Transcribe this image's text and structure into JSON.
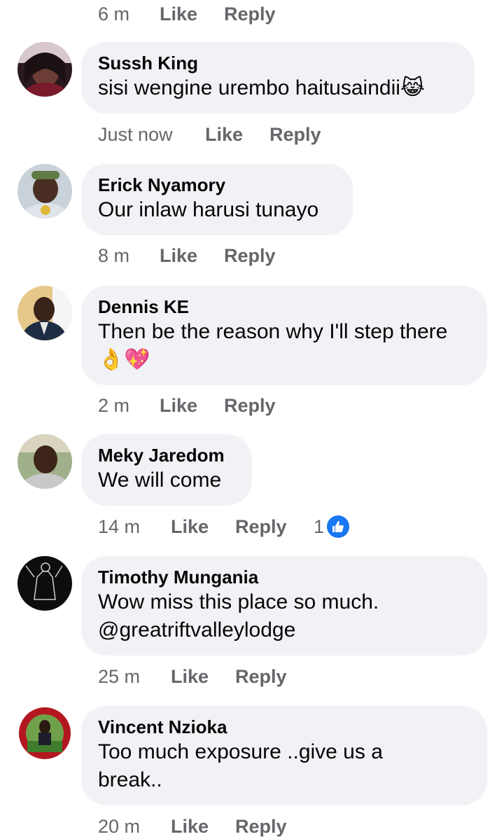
{
  "top_actions": {
    "time": "6 m",
    "like": "Like",
    "reply": "Reply"
  },
  "comments": [
    {
      "name": "Sussh King",
      "text": "sisi wengine urembo haitusaindii",
      "emoji": "😹",
      "time": "Just now",
      "like": "Like",
      "reply": "Reply"
    },
    {
      "name": "Erick Nyamory",
      "text": "Our inlaw harusi tunayo",
      "time": "8 m",
      "like": "Like",
      "reply": "Reply"
    },
    {
      "name": "Dennis KE",
      "text": "Then be the reason why I'll step there",
      "emoji": "👌💖",
      "time": "2 m",
      "like": "Like",
      "reply": "Reply"
    },
    {
      "name": "Meky Jaredom",
      "text": "We will come",
      "time": "14 m",
      "like": "Like",
      "reply": "Reply",
      "reaction_count": "1"
    },
    {
      "name": "Timothy Mungania",
      "text_line1": "Wow miss this place so much.",
      "text_line2": "@greatriftvalleylodge",
      "time": "25 m",
      "like": "Like",
      "reply": "Reply"
    },
    {
      "name": "Vincent Nzioka",
      "text_line1": "Too much exposure ..give us a",
      "text_line2": "break..",
      "time": "20 m",
      "like": "Like",
      "reply": "Reply"
    }
  ],
  "colors": {
    "bubble": "#f0f2f5",
    "meta_text": "#65676b",
    "like_blue": "#1877f2"
  }
}
